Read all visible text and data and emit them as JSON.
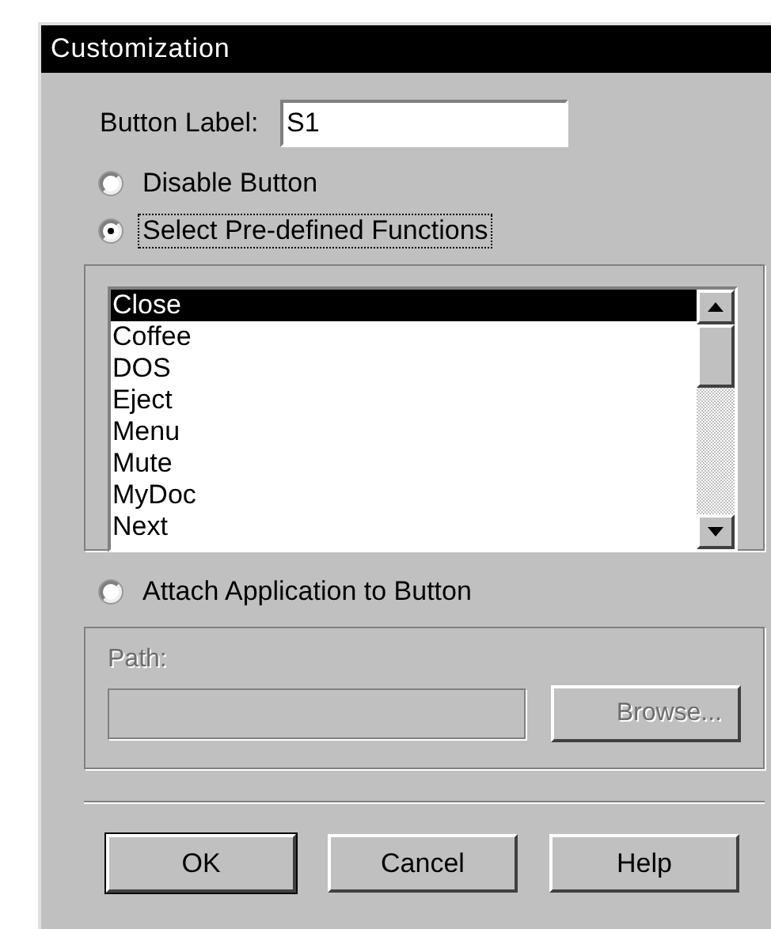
{
  "window": {
    "title": "Customization"
  },
  "button_label": {
    "label": "Button Label:",
    "value": "S1"
  },
  "options": [
    {
      "label": "Disable Button",
      "selected": false,
      "focused": false
    },
    {
      "label": "Select Pre-defined Functions",
      "selected": true,
      "focused": true
    }
  ],
  "functions": {
    "items": [
      {
        "label": "Close",
        "selected": true
      },
      {
        "label": "Coffee",
        "selected": false
      },
      {
        "label": "DOS",
        "selected": false
      },
      {
        "label": "Eject",
        "selected": false
      },
      {
        "label": "Menu",
        "selected": false
      },
      {
        "label": "Mute",
        "selected": false
      },
      {
        "label": "MyDoc",
        "selected": false
      },
      {
        "label": "Next",
        "selected": false
      }
    ]
  },
  "attach_option": {
    "label": "Attach Application to Button",
    "selected": false
  },
  "path": {
    "label": "Path:",
    "disabled": true,
    "browse": "Browse..."
  },
  "buttons": [
    {
      "label": "OK",
      "default": true
    },
    {
      "label": "Cancel",
      "default": false
    },
    {
      "label": "Help",
      "default": false
    }
  ]
}
